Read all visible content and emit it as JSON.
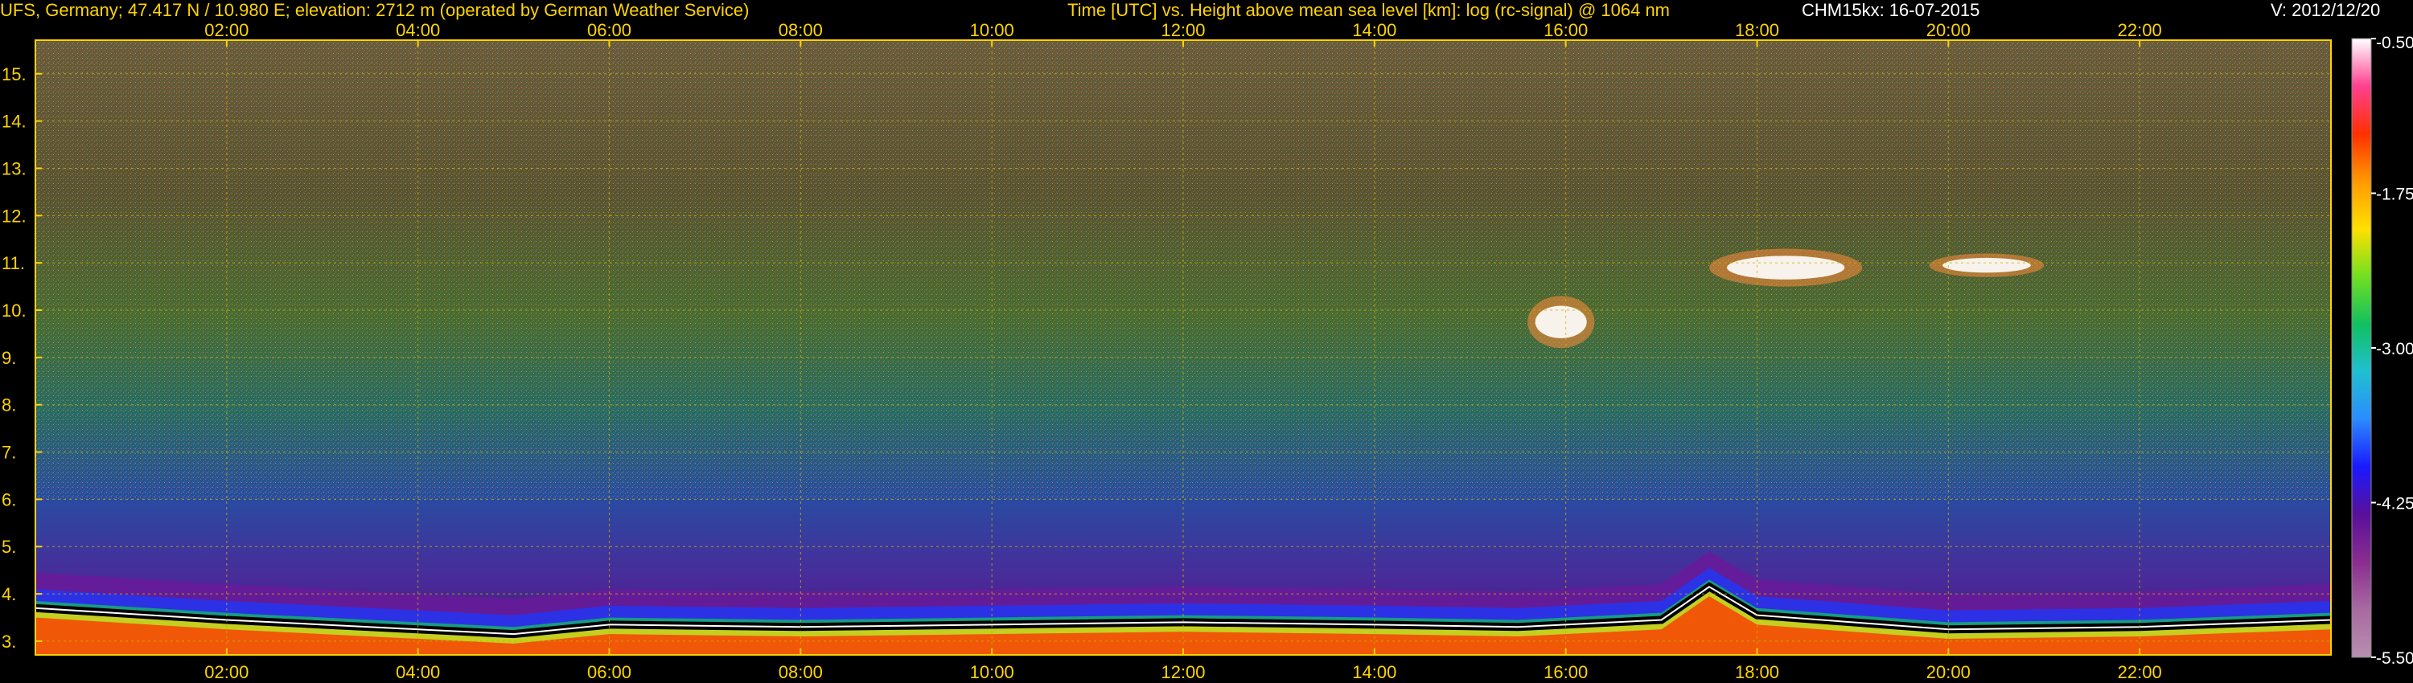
{
  "header": {
    "station": "UFS, Germany; 47.417 N / 10.980 E; elevation: 2712 m  (operated by German Weather Service)",
    "axis_desc": "Time [UTC] vs. Height above mean sea level [km]: log (rc-signal) @ 1064 nm",
    "instrument_date": "CHM15kx: 16-07-2015",
    "version": "V: 2012/12/20"
  },
  "colors": {
    "axis_text": "#ffd400",
    "header_white": "#ffffff",
    "frame": "#ffd400",
    "grid": "#c8b400",
    "background": "#000000"
  },
  "chart_data": {
    "type": "heatmap",
    "x_ticks": [
      "02:00",
      "04:00",
      "06:00",
      "08:00",
      "10:00",
      "12:00",
      "14:00",
      "16:00",
      "18:00",
      "20:00",
      "22:00"
    ],
    "x_tick_hours": [
      2,
      4,
      6,
      8,
      10,
      12,
      14,
      16,
      18,
      20,
      22
    ],
    "xlim_hours": [
      0,
      24
    ],
    "y_ticks": [
      "3.",
      "4.",
      "5.",
      "6.",
      "7.",
      "8.",
      "9.",
      "10.",
      "11.",
      "12.",
      "13.",
      "14.",
      "15."
    ],
    "y_tick_values": [
      3,
      4,
      5,
      6,
      7,
      8,
      9,
      10,
      11,
      12,
      13,
      14,
      15
    ],
    "ylim_km": [
      2.71,
      15.71
    ],
    "grid": true,
    "colorbar": {
      "tick_labels": [
        "-0.50",
        "-1.75",
        "-3.00",
        "-4.25",
        "-5.50"
      ],
      "tick_values": [
        -0.5,
        -1.75,
        -3.0,
        -4.25,
        -5.5
      ],
      "range": [
        -5.5,
        -0.5
      ],
      "colors_low_to_high": [
        "#b88fb0",
        "#a86aa0",
        "#8a2d8f",
        "#5a109a",
        "#1a1aff",
        "#2a8cff",
        "#20c0d0",
        "#10c060",
        "#70e020",
        "#ffe000",
        "#ff9a00",
        "#ff3000",
        "#ff4090",
        "#ffffff"
      ]
    },
    "features": [
      {
        "name": "boundary layer top",
        "points": [
          [
            0,
            3.85
          ],
          [
            2,
            3.6
          ],
          [
            4,
            3.4
          ],
          [
            5,
            3.3
          ],
          [
            6,
            3.5
          ],
          [
            8,
            3.45
          ],
          [
            10,
            3.5
          ],
          [
            12,
            3.55
          ],
          [
            14,
            3.5
          ],
          [
            15.5,
            3.45
          ],
          [
            17,
            3.6
          ],
          [
            17.5,
            4.3
          ],
          [
            18,
            3.7
          ],
          [
            20,
            3.4
          ],
          [
            22,
            3.45
          ],
          [
            24,
            3.6
          ]
        ]
      },
      {
        "name": "cirrus cloud 1",
        "x_hours": [
          15.6,
          16.3
        ],
        "y_km": [
          9.2,
          10.3
        ]
      },
      {
        "name": "cirrus cloud 2",
        "x_hours": [
          17.5,
          19.1
        ],
        "y_km": [
          10.5,
          11.3
        ]
      },
      {
        "name": "cirrus cloud 3",
        "x_hours": [
          19.8,
          21.0
        ],
        "y_km": [
          10.7,
          11.2
        ]
      }
    ]
  }
}
